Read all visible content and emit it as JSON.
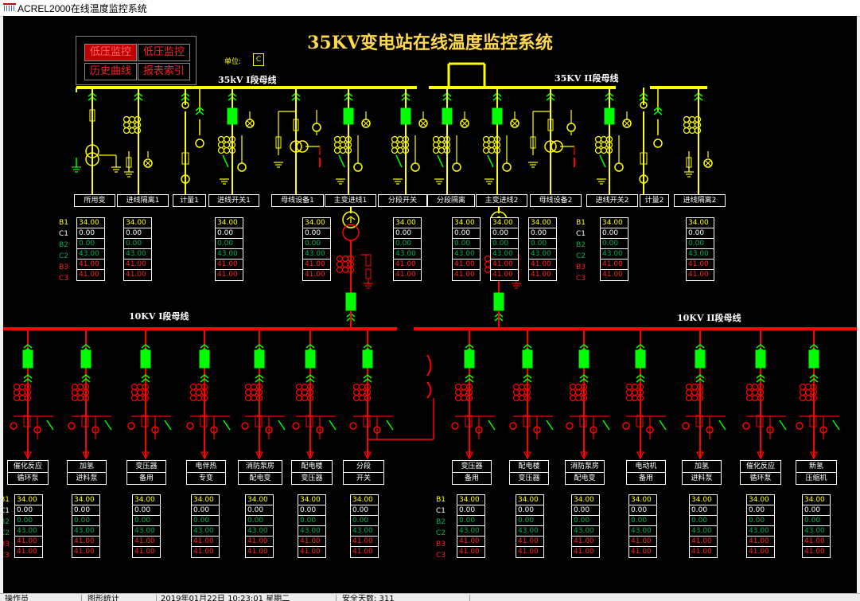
{
  "window": {
    "title": "ACREL2000在线温度监控系统"
  },
  "system_title": "35KV变电站在线温度监控系统",
  "menu": {
    "low_voltage_1": "低压监控",
    "low_voltage_2": "低压监控",
    "history_curve": "历史曲线",
    "report_index": "报表索引"
  },
  "unit": {
    "label": "单位:",
    "value": "C"
  },
  "bus_labels": {
    "hv1": "35kV I段母线",
    "hv2": "35KV II段母线",
    "lv1": "10KV I段母线",
    "lv2": "10KV II段母线"
  },
  "row_labels": [
    "B1",
    "C1",
    "B2",
    "C2",
    "B3",
    "C3"
  ],
  "reading_values": [
    "34.00",
    "0.00",
    "0.00",
    "43.00",
    "41.00",
    "41.00"
  ],
  "value_colors": [
    "#ffff00",
    "#ffffff",
    "#00b050",
    "#00b050",
    "#ff2020",
    "#ff2020"
  ],
  "top_feeders": [
    {
      "label": "所用变"
    },
    {
      "label": "进线隔离1"
    },
    {
      "label": "计量1"
    },
    {
      "label": "进线开关1"
    },
    {
      "label": "母线设备1"
    },
    {
      "label": "主变进线1"
    },
    {
      "label": "分段开关"
    },
    {
      "label": "分段隔离"
    },
    {
      "label": "主变进线2"
    },
    {
      "label": "母线设备2"
    },
    {
      "label": "进线开关2"
    },
    {
      "label": "计量2"
    },
    {
      "label": "进线隔离2"
    }
  ],
  "bottom_feeders": [
    {
      "line1": "催化反应",
      "line2": "循环泵"
    },
    {
      "line1": "加氢",
      "line2": "进料泵"
    },
    {
      "line1": "变压器",
      "line2": "备用"
    },
    {
      "line1": "电伴热",
      "line2": "专变"
    },
    {
      "line1": "消防泵房",
      "line2": "配电变"
    },
    {
      "line1": "配电楼",
      "line2": "变压器"
    },
    {
      "line1": "分段",
      "line2": "开关"
    },
    {
      "line1": "变压器",
      "line2": "备用"
    },
    {
      "line1": "配电楼",
      "line2": "变压器"
    },
    {
      "line1": "消防泵房",
      "line2": "配电变"
    },
    {
      "line1": "电动机",
      "line2": "备用"
    },
    {
      "line1": "加氢",
      "line2": "进料泵"
    },
    {
      "line1": "催化反应",
      "line2": "循环泵"
    },
    {
      "line1": "新氢",
      "line2": "压缩机"
    }
  ],
  "status_bar": [
    "操作员",
    "图形统计",
    "2019年01月22日 10:23:01 星期二",
    "安全天数: 311"
  ],
  "colors": {
    "hv": "#ffff00",
    "lv": "#ff0000",
    "breaker": "#00ff00",
    "ct": "#00ff00",
    "background": "#000000"
  }
}
